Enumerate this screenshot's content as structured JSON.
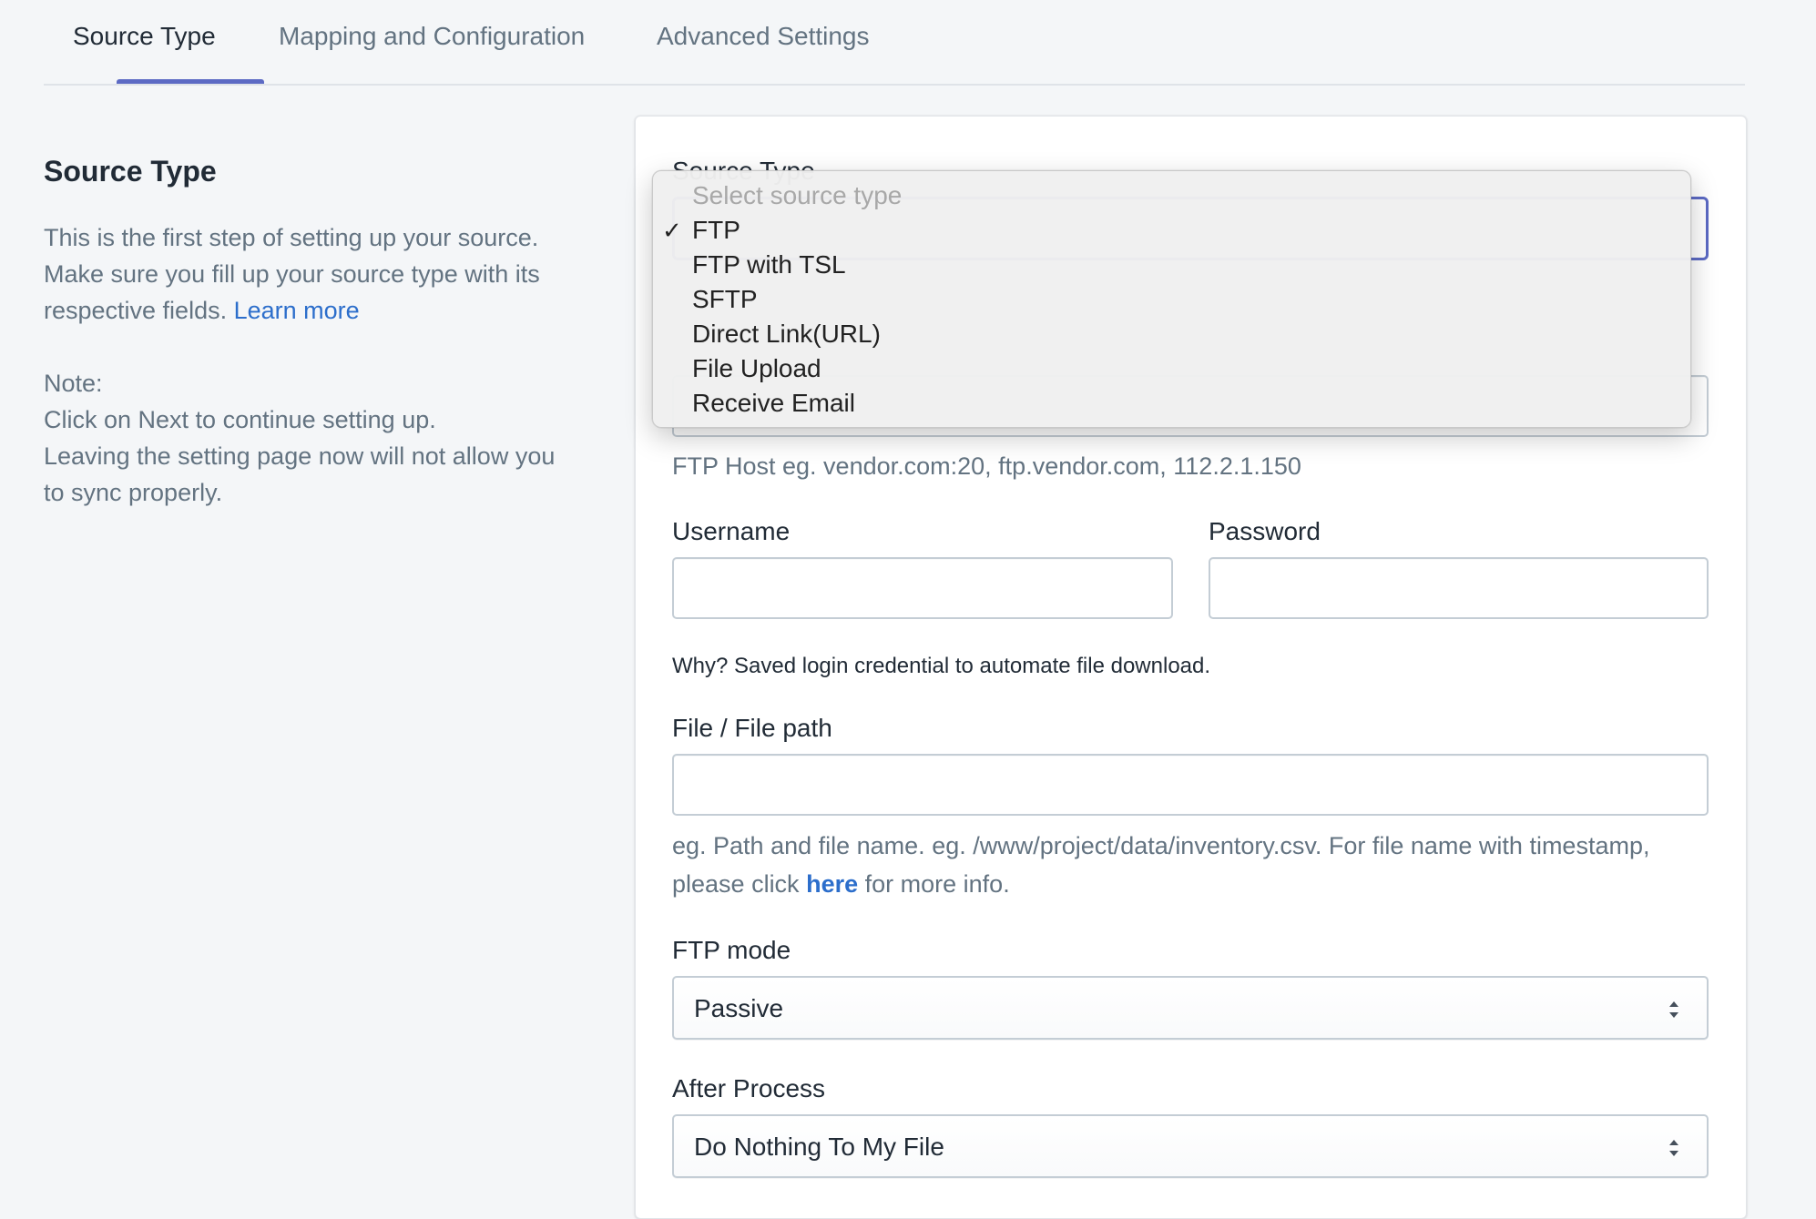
{
  "tabs": [
    "Source Type",
    "Mapping and Configuration",
    "Advanced Settings"
  ],
  "left": {
    "title": "Source Type",
    "line1": "This is the first step of setting up your source.",
    "line2": "Make sure you fill up your source type with its respective fields.",
    "learn_more": "Learn more",
    "note_title": "Note:",
    "note_line1": "Click on Next to continue setting up.",
    "note_line2": "Leaving the setting page now will not allow you to sync properly."
  },
  "form": {
    "source_type_label": "Source Type",
    "ftp_host_help": "FTP Host eg. vendor.com:20, ftp.vendor.com, 112.2.1.150",
    "username_label": "Username",
    "username_value": "",
    "password_label": "Password",
    "password_value": "",
    "credential_note": "Why? Saved login credential to automate file download.",
    "file_path_label": "File / File path",
    "file_path_value": "",
    "file_path_help_pre": "eg. Path and file name. eg. /www/project/data/inventory.csv. For file name with timestamp, please click",
    "file_path_help_link": "here",
    "file_path_help_post": "for more info.",
    "ftp_mode_label": "FTP mode",
    "ftp_mode_value": "Passive",
    "after_process_label": "After Process",
    "after_process_value": "Do Nothing To My File"
  },
  "dropdown": {
    "placeholder": "Select source type",
    "check": "✓",
    "options": [
      "FTP",
      "FTP with TSL",
      "SFTP",
      "Direct Link(URL)",
      "File Upload",
      "Receive Email"
    ],
    "selected": "FTP"
  },
  "colors": {
    "accent": "#5c6ac4",
    "link": "#2c6ecb",
    "background": "#f4f6f8"
  }
}
